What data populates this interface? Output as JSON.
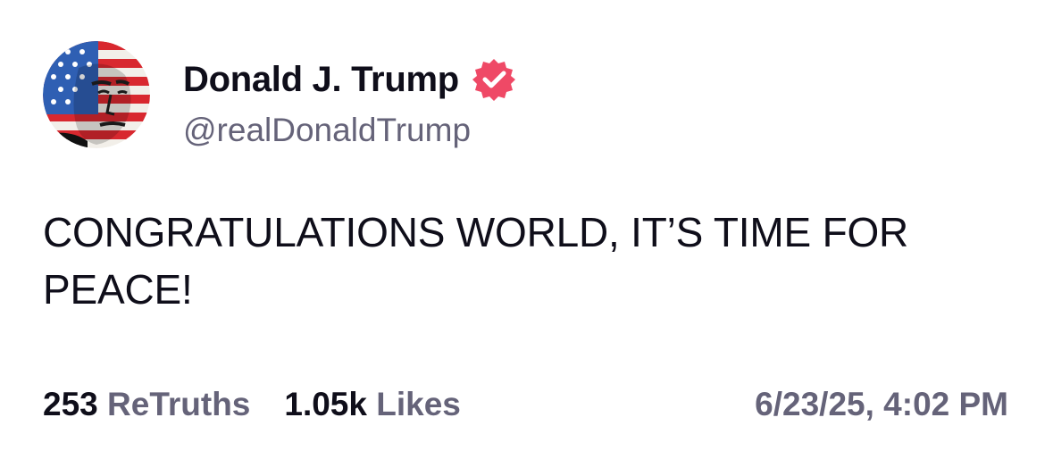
{
  "author": {
    "display_name": "Donald J. Trump",
    "handle": "@realDonaldTrump",
    "verified_badge_icon": "verified-badge-icon",
    "badge_color": "#ef4966"
  },
  "post": {
    "text": "CONGRATULATIONS WORLD, IT’S TIME FOR PEACE!"
  },
  "stats": {
    "retruths_count": "253",
    "retruths_label": "ReTruths",
    "likes_count": "1.05k",
    "likes_label": "Likes"
  },
  "timestamp": "6/23/25, 4:02 PM",
  "colors": {
    "text_primary": "#0f0e1a",
    "text_secondary": "#656379",
    "background": "#ffffff"
  }
}
